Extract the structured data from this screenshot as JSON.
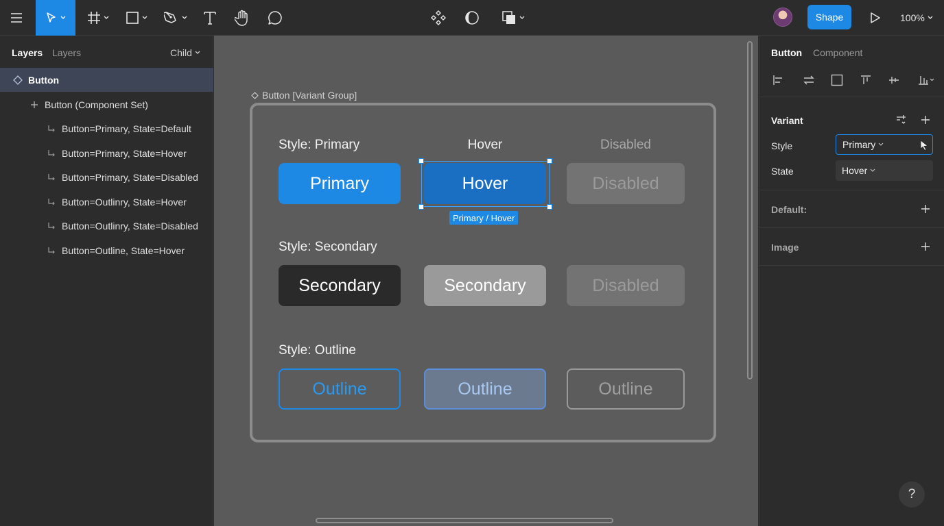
{
  "toolbar": {
    "share_label": "Shape",
    "zoom": "100%",
    "icons": [
      "menu-icon",
      "move-icon",
      "frame-icon",
      "rectangle-icon",
      "pen-icon",
      "text-icon",
      "hand-icon",
      "comment-icon",
      "component-icon",
      "mask-icon",
      "boolean-icon",
      "play-icon"
    ]
  },
  "left_panel": {
    "tabs": [
      "Layers",
      "Layers"
    ],
    "dropdown": "Child",
    "layers": [
      {
        "label": "Button",
        "icon": "component-icon",
        "selected": true
      },
      {
        "label": "Button (Component Set)",
        "icon": "plus-icon"
      },
      {
        "label": "Button=Primary, State=Default",
        "icon": "child-arrow-icon"
      },
      {
        "label": "Button=Primary, State=Hover",
        "icon": "child-arrow-icon"
      },
      {
        "label": "Button=Primary, State=Disabled",
        "icon": "child-arrow-icon"
      },
      {
        "label": "Button=Outlinry, State=Hover",
        "icon": "child-arrow-icon"
      },
      {
        "label": "Button=Outlinry, State=Disabled",
        "icon": "child-arrow-icon"
      },
      {
        "label": "Button=Outline, State=Hover",
        "icon": "child-arrow-icon"
      }
    ]
  },
  "canvas": {
    "frame_label": "Button [Variant Group]",
    "col_hover": "Hover",
    "col_disabled": "Disabled",
    "rows": [
      {
        "title": "Style: Primary",
        "buttons": [
          "Primary",
          "Hover",
          "Disabled"
        ]
      },
      {
        "title": "Style: Secondary",
        "buttons": [
          "Secondary",
          "Secondary",
          "Disabled"
        ]
      },
      {
        "title": "Style: Outline",
        "buttons": [
          "Outline",
          "Outline",
          "Outline"
        ]
      }
    ],
    "selection_tag": "Primary / Hover"
  },
  "right_panel": {
    "tabs": [
      "Button",
      "Component"
    ],
    "variant_title": "Variant",
    "style_label": "Style",
    "style_value": "Primary",
    "state_label": "State",
    "state_value": "Hover",
    "default_title": "Default:",
    "image_title": "Image"
  },
  "help_label": "?",
  "colors": {
    "accent": "#1e88e5",
    "canvas": "#5a5a5a",
    "panel": "#2c2c2c"
  }
}
